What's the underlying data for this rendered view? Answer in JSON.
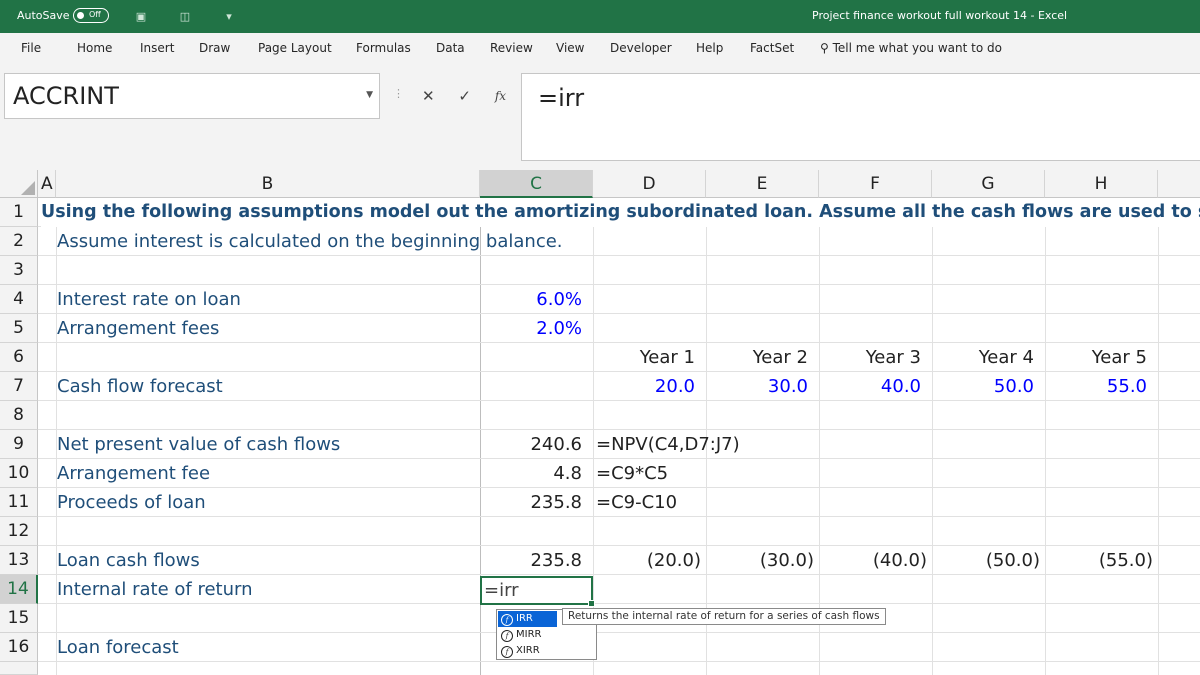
{
  "window": {
    "autosave_label": "AutoSave",
    "autosave_state": "Off",
    "title": "Project finance workout full workout 14  -  Excel"
  },
  "ribbon": {
    "tabs": [
      "File",
      "Home",
      "Insert",
      "Draw",
      "Page Layout",
      "Formulas",
      "Data",
      "Review",
      "View",
      "Developer",
      "Help",
      "FactSet"
    ],
    "tell_me": "Tell me what you want to do"
  },
  "formula_bar": {
    "name_box": "ACCRINT",
    "formula": "=irr",
    "fx": "fx"
  },
  "columns": [
    "A",
    "B",
    "C",
    "D",
    "E",
    "F",
    "G",
    "H"
  ],
  "selected_column": "C",
  "rows": [
    "1",
    "2",
    "3",
    "4",
    "5",
    "6",
    "7",
    "8",
    "9",
    "10",
    "11",
    "12",
    "13",
    "14",
    "15",
    "16"
  ],
  "selected_row": "14",
  "sheet": {
    "r1": "Using the following assumptions model out the amortizing subordinated loan. Assume all the cash flows are used to se",
    "r2": "Assume interest is calculated on the beginning balance.",
    "r4_label": "Interest rate on loan",
    "r4_value": "6.0%",
    "r5_label": "Arrangement fees",
    "r5_value": "2.0%",
    "years": [
      "Year 1",
      "Year 2",
      "Year 3",
      "Year 4",
      "Year 5"
    ],
    "r7_label": "Cash flow forecast",
    "cash_flows": [
      "20.0",
      "30.0",
      "40.0",
      "50.0",
      "55.0"
    ],
    "r9_label": "Net present value of cash flows",
    "r9_value": "240.6",
    "r9_formula": "=NPV(C4,D7:J7)",
    "r10_label": "Arrangement fee",
    "r10_value": "4.8",
    "r10_formula": "=C9*C5",
    "r11_label": "Proceeds of loan",
    "r11_value": "235.8",
    "r11_formula": "=C9-C10",
    "r13_label": "Loan cash flows",
    "r13_value": "235.8",
    "loan_flows": [
      "(20.0)",
      "(30.0)",
      "(40.0)",
      "(50.0)",
      "(55.0)"
    ],
    "r14_label": "Internal rate of return",
    "r14_edit": "=irr",
    "r16_label": "Loan forecast"
  },
  "autocomplete": {
    "items": [
      "IRR",
      "MIRR",
      "XIRR"
    ],
    "selected": "IRR",
    "tooltip": "Returns the internal rate of return for a series of cash flows"
  }
}
